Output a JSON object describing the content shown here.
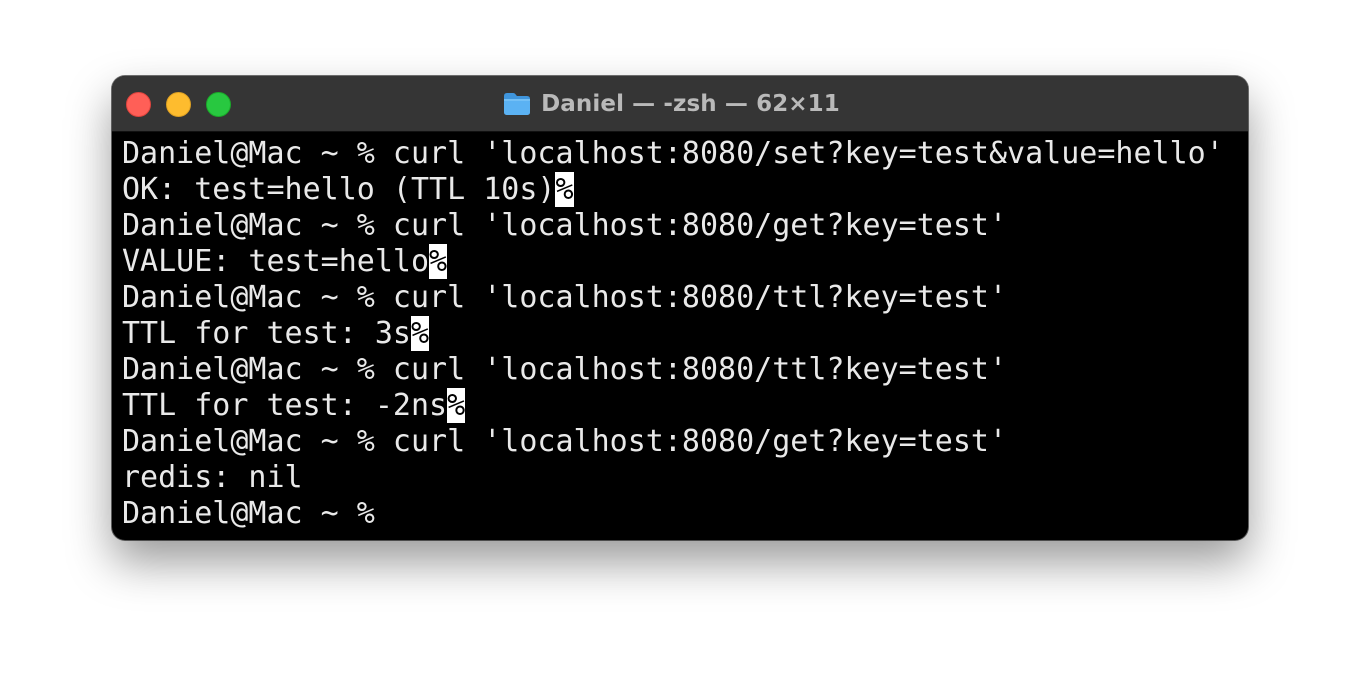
{
  "window": {
    "title": "Daniel — -zsh — 62×11",
    "title_icon": "folder-icon",
    "traffic_lights": {
      "close": "#ff5f57",
      "minimize": "#febc2e",
      "maximize": "#28c840"
    }
  },
  "terminal": {
    "lines": [
      {
        "text": "Daniel@Mac ~ % curl 'localhost:8080/set?key=test&value=hello'",
        "mark": ""
      },
      {
        "text": "OK: test=hello (TTL 10s)",
        "mark": "%"
      },
      {
        "text": "Daniel@Mac ~ % curl 'localhost:8080/get?key=test'",
        "mark": ""
      },
      {
        "text": "VALUE: test=hello",
        "mark": "%"
      },
      {
        "text": "Daniel@Mac ~ % curl 'localhost:8080/ttl?key=test'",
        "mark": ""
      },
      {
        "text": "TTL for test: 3s",
        "mark": "%"
      },
      {
        "text": "Daniel@Mac ~ % curl 'localhost:8080/ttl?key=test'",
        "mark": ""
      },
      {
        "text": "TTL for test: -2ns",
        "mark": "%"
      },
      {
        "text": "Daniel@Mac ~ % curl 'localhost:8080/get?key=test'",
        "mark": ""
      },
      {
        "text": "redis: nil",
        "mark": ""
      },
      {
        "text": "Daniel@Mac ~ % ",
        "mark": ""
      }
    ]
  },
  "colors": {
    "background": "#000000",
    "foreground": "#e9e9e9",
    "titlebar": "#353535",
    "title_text": "#b9b9b9",
    "folder": "#4aa8f0"
  }
}
